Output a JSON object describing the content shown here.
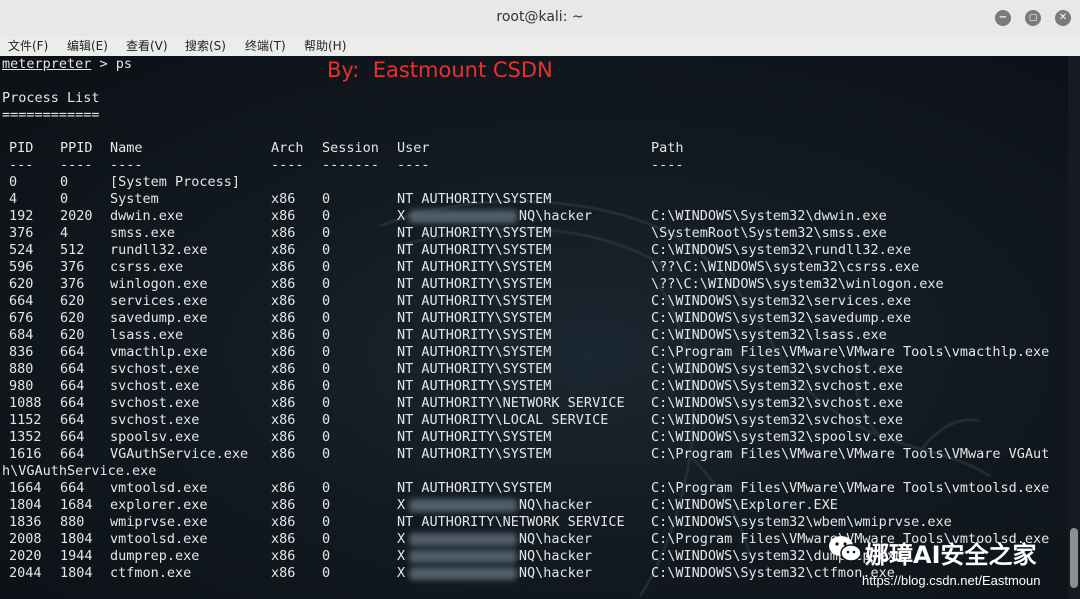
{
  "window": {
    "title": "root@kali: ~"
  },
  "menu": [
    "文件(F)",
    "编辑(E)",
    "查看(V)",
    "搜索(S)",
    "终端(T)",
    "帮助(H)"
  ],
  "prompt": {
    "name": "meterpreter",
    "rest": " > ps"
  },
  "watermark": "By:  Eastmount CSDN",
  "heading": "Process List",
  "heading_rule": "============",
  "columns": [
    "PID",
    "PPID",
    "Name",
    "Arch",
    "Session",
    "User",
    "Path"
  ],
  "separators": [
    "---",
    "----",
    "----",
    "----",
    "-------",
    "----",
    "----"
  ],
  "rows": [
    {
      "pid": "0",
      "ppid": "0",
      "name": "[System Process]",
      "arch": "",
      "session": "",
      "user": "",
      "path": ""
    },
    {
      "pid": "4",
      "ppid": "0",
      "name": "System",
      "arch": "x86",
      "session": "0",
      "user": "NT AUTHORITY\\SYSTEM",
      "path": ""
    },
    {
      "pid": "192",
      "ppid": "2020",
      "name": "dwwin.exe",
      "arch": "x86",
      "session": "0",
      "user": "X              NQ\\hacker",
      "path": "C:\\WINDOWS\\System32\\dwwin.exe"
    },
    {
      "pid": "376",
      "ppid": "4",
      "name": "smss.exe",
      "arch": "x86",
      "session": "0",
      "user": "NT AUTHORITY\\SYSTEM",
      "path": "\\SystemRoot\\System32\\smss.exe"
    },
    {
      "pid": "524",
      "ppid": "512",
      "name": "rundll32.exe",
      "arch": "x86",
      "session": "0",
      "user": "NT AUTHORITY\\SYSTEM",
      "path": "C:\\WINDOWS\\system32\\rundll32.exe"
    },
    {
      "pid": "596",
      "ppid": "376",
      "name": "csrss.exe",
      "arch": "x86",
      "session": "0",
      "user": "NT AUTHORITY\\SYSTEM",
      "path": "\\??\\C:\\WINDOWS\\system32\\csrss.exe"
    },
    {
      "pid": "620",
      "ppid": "376",
      "name": "winlogon.exe",
      "arch": "x86",
      "session": "0",
      "user": "NT AUTHORITY\\SYSTEM",
      "path": "\\??\\C:\\WINDOWS\\system32\\winlogon.exe"
    },
    {
      "pid": "664",
      "ppid": "620",
      "name": "services.exe",
      "arch": "x86",
      "session": "0",
      "user": "NT AUTHORITY\\SYSTEM",
      "path": "C:\\WINDOWS\\system32\\services.exe"
    },
    {
      "pid": "676",
      "ppid": "620",
      "name": "savedump.exe",
      "arch": "x86",
      "session": "0",
      "user": "NT AUTHORITY\\SYSTEM",
      "path": "C:\\WINDOWS\\system32\\savedump.exe"
    },
    {
      "pid": "684",
      "ppid": "620",
      "name": "lsass.exe",
      "arch": "x86",
      "session": "0",
      "user": "NT AUTHORITY\\SYSTEM",
      "path": "C:\\WINDOWS\\system32\\lsass.exe"
    },
    {
      "pid": "836",
      "ppid": "664",
      "name": "vmacthlp.exe",
      "arch": "x86",
      "session": "0",
      "user": "NT AUTHORITY\\SYSTEM",
      "path": "C:\\Program Files\\VMware\\VMware Tools\\vmacthlp.exe"
    },
    {
      "pid": "880",
      "ppid": "664",
      "name": "svchost.exe",
      "arch": "x86",
      "session": "0",
      "user": "NT AUTHORITY\\SYSTEM",
      "path": "C:\\WINDOWS\\system32\\svchost.exe"
    },
    {
      "pid": "980",
      "ppid": "664",
      "name": "svchost.exe",
      "arch": "x86",
      "session": "0",
      "user": "NT AUTHORITY\\SYSTEM",
      "path": "C:\\WINDOWS\\System32\\svchost.exe"
    },
    {
      "pid": "1088",
      "ppid": "664",
      "name": "svchost.exe",
      "arch": "x86",
      "session": "0",
      "user": "NT AUTHORITY\\NETWORK SERVICE",
      "path": "C:\\WINDOWS\\system32\\svchost.exe"
    },
    {
      "pid": "1152",
      "ppid": "664",
      "name": "svchost.exe",
      "arch": "x86",
      "session": "0",
      "user": "NT AUTHORITY\\LOCAL SERVICE",
      "path": "C:\\WINDOWS\\system32\\svchost.exe"
    },
    {
      "pid": "1352",
      "ppid": "664",
      "name": "spoolsv.exe",
      "arch": "x86",
      "session": "0",
      "user": "NT AUTHORITY\\SYSTEM",
      "path": "C:\\WINDOWS\\system32\\spoolsv.exe"
    },
    {
      "pid": "1616",
      "ppid": "664",
      "name": "VGAuthService.exe",
      "arch": "x86",
      "session": "0",
      "user": "NT AUTHORITY\\SYSTEM",
      "path": "C:\\Program Files\\VMware\\VMware Tools\\VMware VGAut"
    },
    {
      "wrap": "h\\VGAuthService.exe"
    },
    {
      "pid": "1664",
      "ppid": "664",
      "name": "vmtoolsd.exe",
      "arch": "x86",
      "session": "0",
      "user": "NT AUTHORITY\\SYSTEM",
      "path": "C:\\Program Files\\VMware\\VMware Tools\\vmtoolsd.exe"
    },
    {
      "pid": "1804",
      "ppid": "1684",
      "name": "explorer.exe",
      "arch": "x86",
      "session": "0",
      "user": "X              NQ\\hacker",
      "path": "C:\\WINDOWS\\Explorer.EXE"
    },
    {
      "pid": "1836",
      "ppid": "880",
      "name": "wmiprvse.exe",
      "arch": "x86",
      "session": "0",
      "user": "NT AUTHORITY\\NETWORK SERVICE",
      "path": "C:\\WINDOWS\\system32\\wbem\\wmiprvse.exe"
    },
    {
      "pid": "2008",
      "ppid": "1804",
      "name": "vmtoolsd.exe",
      "arch": "x86",
      "session": "0",
      "user": "X              NQ\\hacker",
      "path": "C:\\Program Files\\VMware\\VMware Tools\\vmtoolsd.exe"
    },
    {
      "pid": "2020",
      "ppid": "1944",
      "name": "dumprep.exe",
      "arch": "x86",
      "session": "0",
      "user": "X              NQ\\hacker",
      "path": "C:\\WINDOWS\\system32\\dumprep.exe"
    },
    {
      "pid": "2044",
      "ppid": "1804",
      "name": "ctfmon.exe",
      "arch": "x86",
      "session": "0",
      "user": "X              NQ\\hacker",
      "path": "C:\\WINDOWS\\System32\\ctfmon.exe"
    }
  ],
  "overlay": {
    "wechat_label": "娜璋AI安全之家",
    "url": "https://blog.csdn.net/Eastmoun"
  }
}
